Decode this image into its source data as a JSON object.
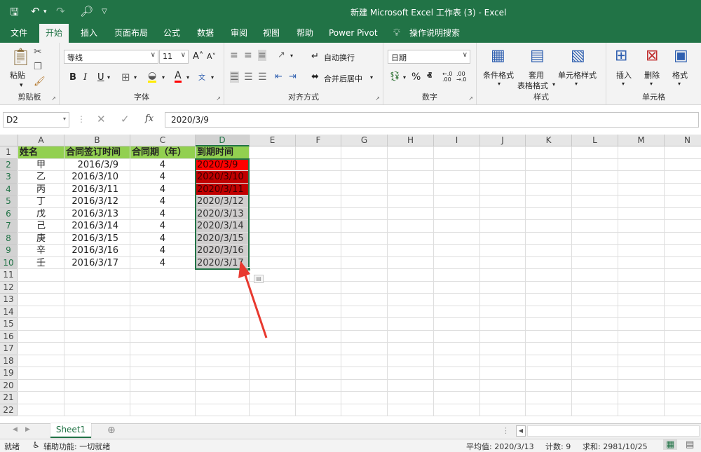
{
  "window": {
    "title": "新建 Microsoft Excel 工作表 (3)  -  Excel"
  },
  "menu": {
    "tabs": [
      "文件",
      "开始",
      "插入",
      "页面布局",
      "公式",
      "数据",
      "审阅",
      "视图",
      "帮助",
      "Power Pivot"
    ],
    "active": "开始",
    "tell_me": "操作说明搜索"
  },
  "ribbon": {
    "clipboard": {
      "label": "剪贴板",
      "paste": "粘贴"
    },
    "font": {
      "label": "字体",
      "name": "等线",
      "size": "11"
    },
    "alignment": {
      "label": "对齐方式",
      "wrap": "自动换行",
      "merge": "合并后居中"
    },
    "number": {
      "label": "数字",
      "format": "日期"
    },
    "styles": {
      "label": "样式",
      "conditional": "条件格式",
      "table_line1": "套用",
      "table_line2": "表格格式",
      "cell_styles": "单元格样式"
    },
    "cells": {
      "label": "单元格",
      "insert": "插入",
      "delete": "删除",
      "format": "格式"
    }
  },
  "formula_bar": {
    "name_box": "D2",
    "formula": "2020/3/9"
  },
  "sheet": {
    "columns": [
      "A",
      "B",
      "C",
      "D",
      "E",
      "F",
      "G",
      "H",
      "I",
      "J",
      "K",
      "L",
      "M",
      "N"
    ],
    "rows": [
      "1",
      "2",
      "3",
      "4",
      "5",
      "6",
      "7",
      "8",
      "9",
      "10",
      "11",
      "12",
      "13",
      "14",
      "15",
      "16",
      "17",
      "18",
      "19",
      "20",
      "21",
      "22"
    ],
    "header": [
      "姓名",
      "合同签订时间",
      "合同期（年）",
      "到期时间"
    ],
    "data": [
      [
        "甲",
        "2016/3/9",
        "4",
        "2020/3/9"
      ],
      [
        "乙",
        "2016/3/10",
        "4",
        "2020/3/10"
      ],
      [
        "丙",
        "2016/3/11",
        "4",
        "2020/3/11"
      ],
      [
        "丁",
        "2016/3/12",
        "4",
        "2020/3/12"
      ],
      [
        "戊",
        "2016/3/13",
        "4",
        "2020/3/13"
      ],
      [
        "己",
        "2016/3/14",
        "4",
        "2020/3/14"
      ],
      [
        "庚",
        "2016/3/15",
        "4",
        "2020/3/15"
      ],
      [
        "辛",
        "2016/3/16",
        "4",
        "2020/3/16"
      ],
      [
        "壬",
        "2016/3/17",
        "4",
        "2020/3/17"
      ]
    ],
    "highlight_rows": 3,
    "selected_column": "D",
    "tab": "Sheet1"
  },
  "status": {
    "ready": "就绪",
    "accessibility": "辅助功能: 一切就绪",
    "average": "平均值: 2020/3/13",
    "count": "计数: 9",
    "sum": "求和: 2981/10/25"
  },
  "colors": {
    "accent": "#217346",
    "header_fill": "#92d050",
    "red_fill": "#ff0000",
    "dark_red_fill": "#c00000",
    "gray_fill": "#d0cece"
  }
}
